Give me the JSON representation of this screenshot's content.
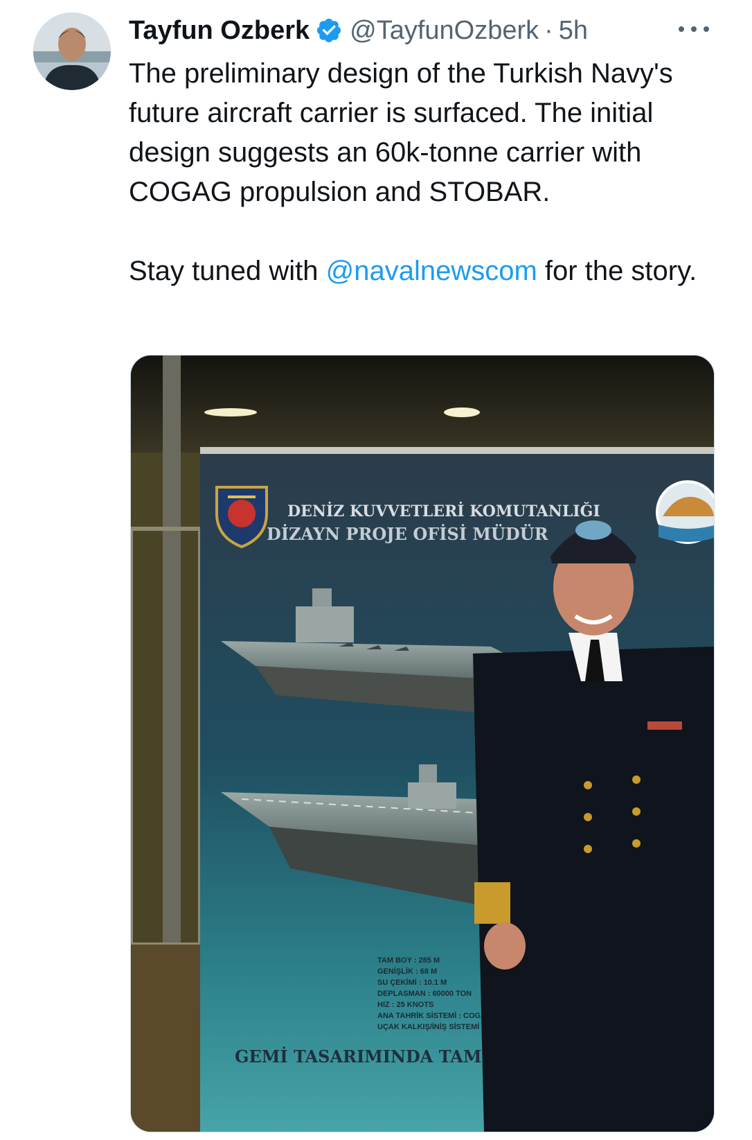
{
  "author": {
    "name": "Tayfun Ozberk",
    "handle": "@TayfunOzberk",
    "separator": "·",
    "time": "5h",
    "verified": true,
    "avatar_icon": "profile-avatar"
  },
  "tweet": {
    "paragraph1": "The preliminary design of the Turkish Navy's future aircraft carrier is surfaced. The initial design suggests an 60k-tonne carrier with COGAG propulsion and STOBAR.",
    "paragraph2_prefix": "Stay tuned with ",
    "mention": "@navalnewscom",
    "paragraph2_suffix": " for the story."
  },
  "media": {
    "poster_line1": "DENİZ KUVVETLERİ KOMUTANLIĞI",
    "poster_line2": "DİZAYN PROJE OFİSİ MÜDÜR",
    "specs": [
      "TAM BOY : 285 M",
      "GENİŞLİK : 68 M",
      "SU ÇEKİMİ : 10.1 M",
      "DEPLASMAN : 60000 TON",
      "HIZ : 25 KNOTS",
      "ANA TAHRİK SİSTEMİ : COGAG",
      "UÇAK KALKIŞ/İNİŞ SİSTEMİ : STOBAR"
    ],
    "footer_text": "GEMİ TASARIMINDA TAM V"
  },
  "colors": {
    "link": "#1d9bf0",
    "verified": "#1d9bf0",
    "secondary": "#536471"
  }
}
